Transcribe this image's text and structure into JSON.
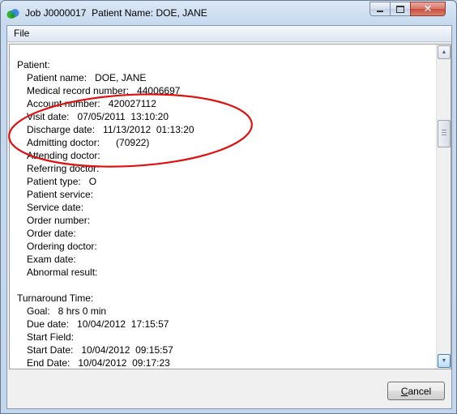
{
  "window": {
    "title": "Job J0000017  Patient Name: DOE, JANE"
  },
  "menu": {
    "file_label": "File"
  },
  "report": {
    "lines": [
      {
        "text": "Patient:",
        "indent": false
      },
      {
        "text": "Patient name:   DOE, JANE",
        "indent": true
      },
      {
        "text": "Medical record number:   44006697",
        "indent": true
      },
      {
        "text": "Account number:   420027112",
        "indent": true
      },
      {
        "text": "Visit date:   07/05/2011  13:10:20",
        "indent": true
      },
      {
        "text": "Discharge date:   11/13/2012  01:13:20",
        "indent": true
      },
      {
        "text": "Admitting doctor:      (70922)",
        "indent": true
      },
      {
        "text": "Attending doctor:",
        "indent": true
      },
      {
        "text": "Referring doctor:",
        "indent": true
      },
      {
        "text": "Patient type:   O",
        "indent": true
      },
      {
        "text": "Patient service:",
        "indent": true
      },
      {
        "text": "Service date:",
        "indent": true
      },
      {
        "text": "Order number:",
        "indent": true
      },
      {
        "text": "Order date:",
        "indent": true
      },
      {
        "text": "Ordering doctor:",
        "indent": true
      },
      {
        "text": "Exam date:",
        "indent": true
      },
      {
        "text": "Abnormal result:",
        "indent": true
      },
      {
        "text": "",
        "indent": false
      },
      {
        "text": "Turnaround Time:",
        "indent": false
      },
      {
        "text": "Goal:   8 hrs 0 min",
        "indent": true
      },
      {
        "text": "Due date:   10/04/2012  17:15:57",
        "indent": true
      },
      {
        "text": "Start Field:",
        "indent": true
      },
      {
        "text": "Start Date:   10/04/2012  09:15:57",
        "indent": true
      },
      {
        "text": "End Date:   10/04/2012  09:17:23",
        "indent": true
      }
    ]
  },
  "buttons": {
    "cancel_prefix": "",
    "cancel_underlined": "C",
    "cancel_rest": "ancel"
  },
  "icons": {
    "app": "app-logo-icon",
    "minimize": "minimize-icon",
    "maximize": "maximize-icon",
    "close": "close-icon",
    "scroll_up": "scroll-up-arrow-icon",
    "scroll_down": "scroll-down-arrow-icon"
  },
  "colors": {
    "annotation_ellipse": "#e11010"
  },
  "scroll": {
    "position_fraction": 0.23
  }
}
